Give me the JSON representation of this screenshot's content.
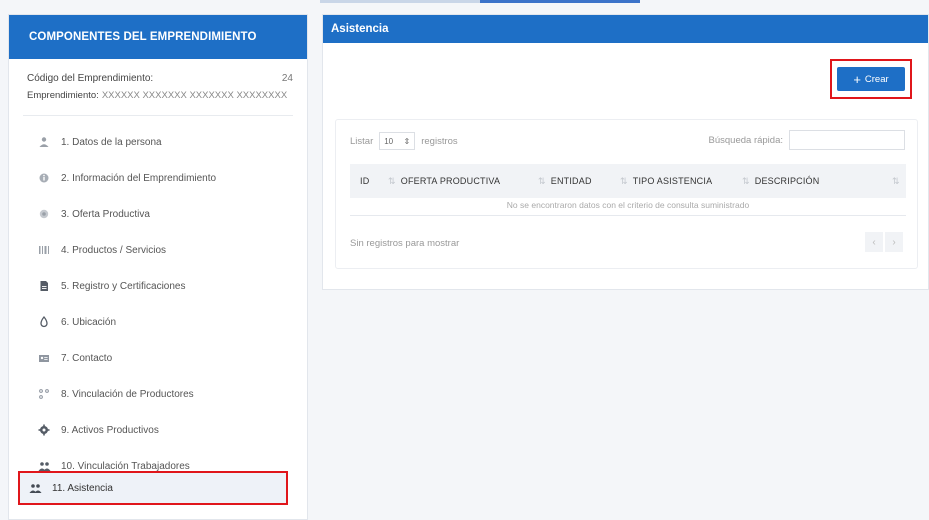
{
  "left": {
    "header": "COMPONENTES DEL EMPRENDIMIENTO",
    "codigo_label": "Código del Emprendimiento:",
    "codigo_value": "24",
    "emp_label": "Emprendimiento:",
    "emp_value": "XXXXXX XXXXXXX XXXXXXX XXXXXXXX",
    "items": [
      {
        "label": "1. Datos de la persona",
        "icon": "person-icon"
      },
      {
        "label": "2. Información del Emprendimiento",
        "icon": "info-icon"
      },
      {
        "label": "3. Oferta Productiva",
        "icon": "offer-icon"
      },
      {
        "label": "4. Productos / Servicios",
        "icon": "barcode-icon"
      },
      {
        "label": "5. Registro y Certificaciones",
        "icon": "document-icon"
      },
      {
        "label": "6. Ubicación",
        "icon": "location-icon"
      },
      {
        "label": "7. Contacto",
        "icon": "contact-card-icon"
      },
      {
        "label": "8. Vinculación de Productores",
        "icon": "network-icon"
      },
      {
        "label": "9. Activos Productivos",
        "icon": "gear-icon"
      },
      {
        "label": "10. Vinculación Trabajadores",
        "icon": "group-icon"
      },
      {
        "label": "11. Asistencia",
        "icon": "group-icon"
      }
    ]
  },
  "right": {
    "header": "Asistencia",
    "crear_label": "Crear",
    "listar_label": "Listar",
    "page_size": "10",
    "registros_label": "registros",
    "search_label": "Búsqueda rápida:",
    "search_value": "",
    "columns": [
      "ID",
      "OFERTA PRODUCTIVA",
      "ENTIDAD",
      "TIPO ASISTENCIA",
      "DESCRIPCIÓN"
    ],
    "empty_message": "No se encontraron datos con el criterio de consulta suministrado",
    "info_text": "Sin registros para mostrar"
  }
}
